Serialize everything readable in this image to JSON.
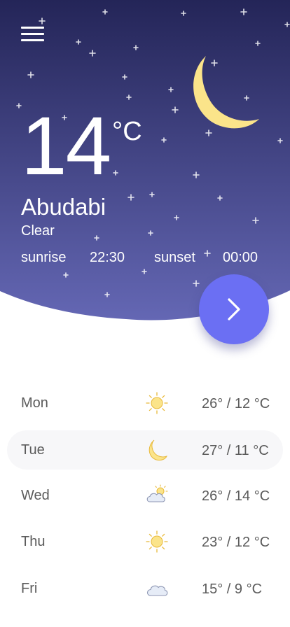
{
  "colors": {
    "sky_top": "#242558",
    "sky_bottom": "#6467b4",
    "moon": "#fbe48a",
    "accent": "#6b6ff3",
    "text_dark": "#5b5b5b",
    "row_highlight": "#f7f7f9"
  },
  "header": {
    "menu_icon": "hamburger-menu-icon"
  },
  "current": {
    "temperature": "14",
    "unit": "°C",
    "city": "Abudabi",
    "condition": "Clear",
    "condition_icon": "crescent-moon-icon",
    "sunrise_label": "sunrise",
    "sunrise_time": "22:30",
    "sunset_label": "sunset",
    "sunset_time": "00:00"
  },
  "next_button": {
    "icon": "chevron-right-icon"
  },
  "forecast": [
    {
      "day": "Mon",
      "icon": "sun-icon",
      "temps": "26° / 12 °C"
    },
    {
      "day": "Tue",
      "icon": "moon-icon",
      "temps": "27° / 11 °C",
      "selected": true
    },
    {
      "day": "Wed",
      "icon": "partly-cloudy-icon",
      "temps": "26° / 14 °C"
    },
    {
      "day": "Thu",
      "icon": "sun-icon",
      "temps": "23° / 12 °C"
    },
    {
      "day": "Fri",
      "icon": "cloud-icon",
      "temps": "15° / 9 °C"
    }
  ]
}
